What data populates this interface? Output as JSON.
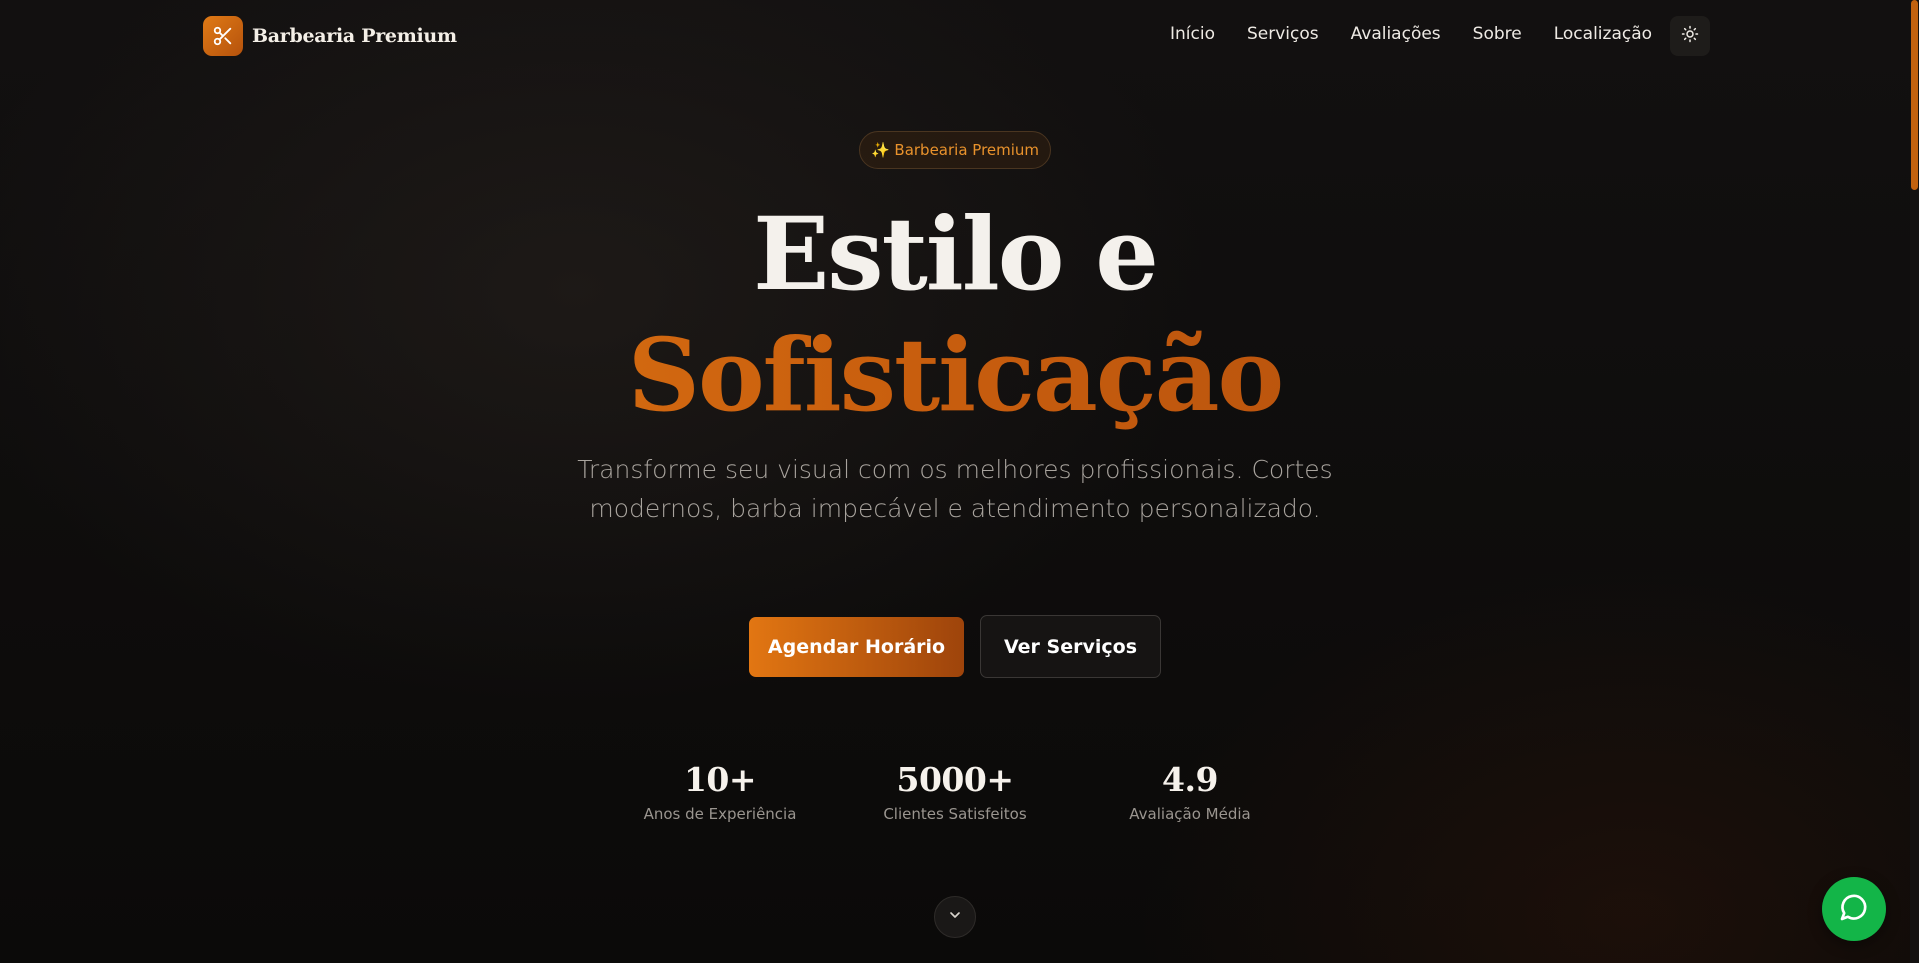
{
  "nav": {
    "brand_name": "Barbearia Premium",
    "links": [
      "Início",
      "Serviços",
      "Avaliações",
      "Sobre",
      "Localização"
    ],
    "theme_icon": "sun-icon",
    "logo_icon": "scissors-icon"
  },
  "hero": {
    "badge": "✨ Barbearia Premium",
    "title_line1": "Estilo e",
    "title_line2": "Sofisticação",
    "lead": "Transforme seu visual com os melhores profissionais. Cortes modernos, barba impecável e atendimento personalizado.",
    "cta_primary": "Agendar Horário",
    "cta_secondary": "Ver Serviços"
  },
  "stats": [
    {
      "value": "10+",
      "label": "Anos de Experiência"
    },
    {
      "value": "5000+",
      "label": "Clientes Satisfeitos"
    },
    {
      "value": "4.9",
      "label": "Avaliação Média"
    }
  ],
  "floating": {
    "scroll_icon": "chevron-down-icon",
    "whatsapp_icon": "whatsapp-chat-icon"
  },
  "colors": {
    "accent": "#e07a16",
    "accent_dark": "#9e440b",
    "background": "#0e0c0b",
    "whatsapp": "#13b548"
  }
}
